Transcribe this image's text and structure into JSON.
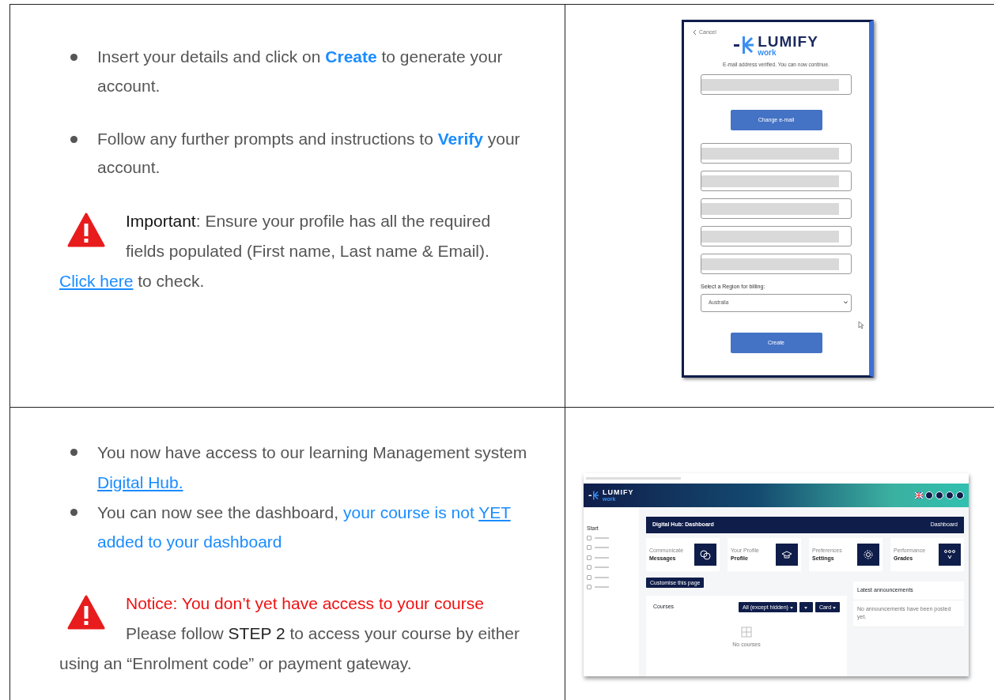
{
  "rows": [
    {
      "instructions": [
        {
          "segments": [
            {
              "kind": "plain",
              "text": "Insert your details and click on "
            },
            {
              "kind": "strong",
              "text": "Create"
            },
            {
              "kind": "plain",
              "text": " to generate your account."
            }
          ]
        },
        {
          "segments": [
            {
              "kind": "plain",
              "text": "Follow any further prompts and instructions to "
            },
            {
              "kind": "strong",
              "text": "Verify"
            },
            {
              "kind": "plain",
              "text": " your account."
            }
          ]
        }
      ],
      "notice": {
        "color": "#111111",
        "highlighted": false,
        "label": "Important",
        "text": ": Ensure your profile has all the required fields populated (First name, Last name & Email).",
        "followup": [
          {
            "kind": "link",
            "text": "Click here"
          },
          {
            "kind": "plain",
            "text": " to check."
          }
        ]
      },
      "screenshot": {
        "kind": "signup",
        "cancel": "Cancel",
        "brand": "LUMIFY",
        "brand_sub": "work",
        "message": "E-mail address verified. You can now continue.",
        "email_field": {
          "redacted": true
        },
        "change_button": "Change e-mail",
        "profile_fields": [
          {
            "redacted": true
          },
          {
            "redacted": true
          },
          {
            "redacted": true
          },
          {
            "redacted": true
          },
          {
            "redacted": true
          }
        ],
        "region_label": "Select a Region for billing:",
        "region_select": "Australia",
        "submit_button": "Create"
      }
    },
    {
      "instructions": [
        {
          "segments": [
            {
              "kind": "plain",
              "text": "You now have access to our learning Management system "
            },
            {
              "kind": "link",
              "text": "Digital Hub."
            }
          ]
        },
        {
          "segments": [
            {
              "kind": "plain",
              "text": "You can now see the dashboard, "
            },
            {
              "kind": "highlight",
              "text": "your course is not "
            },
            {
              "kind": "highlight_underline",
              "text": "YET"
            },
            {
              "kind": "highlight",
              "text": " added to your dashboard"
            }
          ]
        }
      ],
      "notice": {
        "color": "#f01010",
        "highlighted": true,
        "label": "Notice",
        "text": ": You don’t yet have access to your course",
        "followup": [
          {
            "kind": "plain",
            "text": "Please follow "
          },
          {
            "kind": "emphasis",
            "text": "STEP 2"
          },
          {
            "kind": "plain",
            "text": " to access your course by either using an “Enrolment code” or payment gateway."
          }
        ]
      },
      "screenshot": {
        "kind": "dashboard",
        "brand": "LUMIFY",
        "brand_sub": "work",
        "sidebar_heading": "Start",
        "page_title": "Digital Hub: Dashboard",
        "breadcrumb": "Dashboard",
        "tiles": [
          {
            "caption": "Communicate",
            "title": "Messages"
          },
          {
            "caption": "Your Profile",
            "title": "Profile"
          },
          {
            "caption": "Preferences",
            "title": "Settings"
          },
          {
            "caption": "Performance",
            "title": "Grades"
          }
        ],
        "customise_button": "Customise this page",
        "courses": {
          "title": "Courses",
          "filters": [
            {
              "kind": "dropdown",
              "label": "All (except hidden)"
            },
            {
              "kind": "caret"
            },
            {
              "kind": "dropdown",
              "label": "Card"
            }
          ],
          "empty_message": "No courses"
        },
        "announcements": {
          "title": "Latest announcements",
          "message": "No announcements have been posted yet."
        }
      }
    }
  ]
}
